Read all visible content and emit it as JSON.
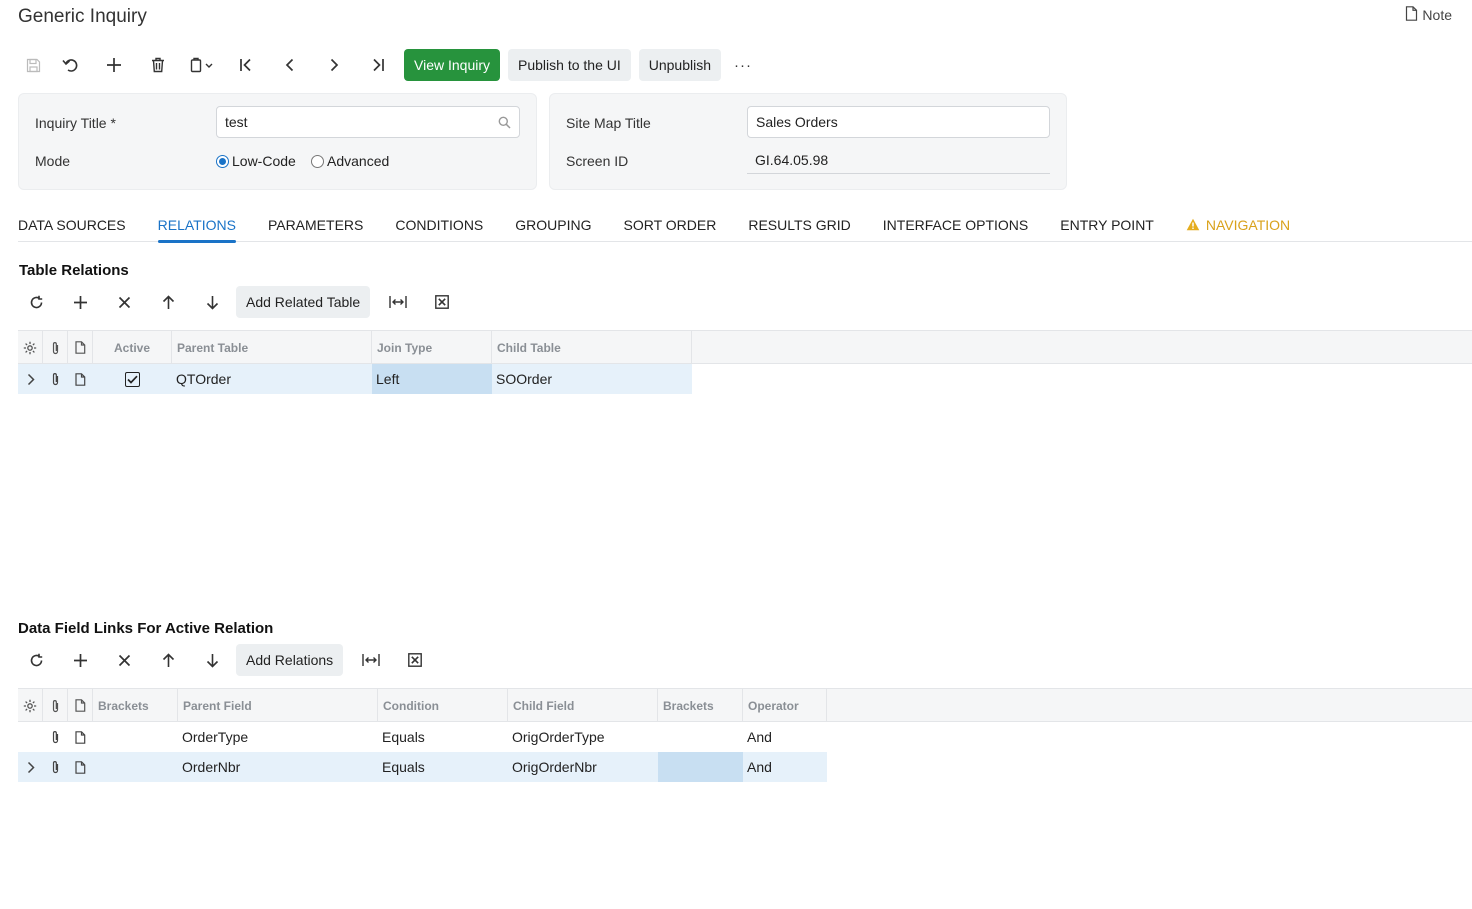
{
  "page": {
    "title": "Generic Inquiry",
    "note_label": "Note"
  },
  "toolbar": {
    "icons": [
      "save-icon",
      "undo-icon",
      "add-icon",
      "delete-icon",
      "copy-paste-icon",
      "first-icon",
      "previous-icon",
      "next-icon",
      "last-icon",
      "more-icon"
    ],
    "view_inquiry": "View Inquiry",
    "publish": "Publish to the UI",
    "unpublish": "Unpublish",
    "more": "···"
  },
  "header": {
    "inquiry_title_label": "Inquiry Title *",
    "inquiry_title_value": "test",
    "mode_label": "Mode",
    "mode_options": [
      "Low-Code",
      "Advanced"
    ],
    "mode_selected": "Low-Code",
    "site_map_title_label": "Site Map Title",
    "site_map_title_value": "Sales Orders",
    "screen_id_label": "Screen ID",
    "screen_id_value": "GI.64.05.98"
  },
  "tabs": [
    {
      "label": "DATA SOURCES"
    },
    {
      "label": "RELATIONS"
    },
    {
      "label": "PARAMETERS"
    },
    {
      "label": "CONDITIONS"
    },
    {
      "label": "GROUPING"
    },
    {
      "label": "SORT ORDER"
    },
    {
      "label": "RESULTS GRID"
    },
    {
      "label": "INTERFACE OPTIONS"
    },
    {
      "label": "ENTRY POINT"
    },
    {
      "label": "NAVIGATION"
    }
  ],
  "active_tab": "RELATIONS",
  "warning_tab": "NAVIGATION",
  "table_relations": {
    "title": "Table Relations",
    "toolbar_icons": [
      "refresh-icon",
      "add-icon",
      "delete-icon",
      "move-up-icon",
      "move-down-icon",
      "fit-columns-icon",
      "export-excel-icon"
    ],
    "add_button": "Add Related Table",
    "columns": [
      "Active",
      "Parent Table",
      "Join Type",
      "Child Table"
    ],
    "rows": [
      {
        "active": true,
        "parent_table": "QTOrder",
        "join_type": "Left",
        "child_table": "SOOrder"
      }
    ]
  },
  "field_links": {
    "title": "Data Field Links For Active Relation",
    "toolbar_icons": [
      "refresh-icon",
      "add-icon",
      "delete-icon",
      "move-up-icon",
      "move-down-icon",
      "fit-columns-icon",
      "export-excel-icon"
    ],
    "add_button": "Add Relations",
    "columns": [
      "Brackets",
      "Parent Field",
      "Condition",
      "Child Field",
      "Brackets",
      "Operator"
    ],
    "rows": [
      {
        "open_bracket": "",
        "parent_field": "OrderType",
        "condition": "Equals",
        "child_field": "OrigOrderType",
        "close_bracket": "",
        "operator": "And"
      },
      {
        "open_bracket": "",
        "parent_field": "OrderNbr",
        "condition": "Equals",
        "child_field": "OrigOrderNbr",
        "close_bracket": "",
        "operator": "And"
      }
    ]
  },
  "colors": {
    "accent": "#1a73c7",
    "primary_button": "#27933d",
    "warning": "#d9a21b",
    "selected_row": "#e6f1fa",
    "selected_cell": "#c8dff2"
  }
}
